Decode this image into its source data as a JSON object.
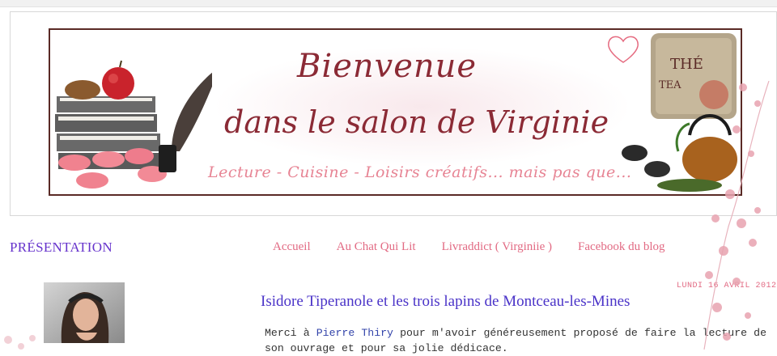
{
  "colors": {
    "banner_border": "#5a2a26",
    "banner_title": "#8b2a35",
    "banner_subtitle": "#e78494",
    "nav_link": "#e26a83",
    "section_title": "#6633cc",
    "post_title": "#4a33c8",
    "author_link": "#3344aa",
    "blossom": "#e8a3b0"
  },
  "banner": {
    "title_line1": "Bienvenue",
    "title_line2": "dans le salon de Virginie",
    "subtitle": "Lecture - Cuisine - Loisirs créatifs... mais pas que...",
    "tea_box_label": "THÉ",
    "tea_box_label2": "TEA"
  },
  "sidebar": {
    "section_title": "PRÉSENTATION"
  },
  "nav": {
    "items": [
      {
        "label": "Accueil"
      },
      {
        "label": "Au Chat Qui Lit"
      },
      {
        "label": "Livraddict ( Virginiie )"
      },
      {
        "label": "Facebook du blog"
      }
    ]
  },
  "post": {
    "date": "LUNDI 16 AVRIL 2012",
    "title": "Isidore Tiperanole et les trois lapins de Montceau-les-Mines",
    "body_prefix": "Merci à ",
    "author": "Pierre Thiry",
    "body_suffix": " pour m'avoir généreusement proposé de faire la lecture de son ouvrage et pour sa jolie dédicace."
  }
}
